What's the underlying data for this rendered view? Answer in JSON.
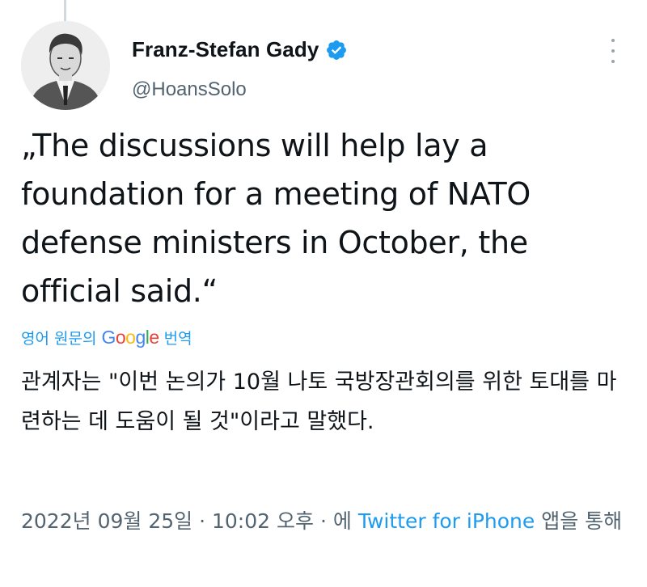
{
  "author": {
    "name": "Franz-Stefan Gady",
    "handle": "@HoansSolo",
    "verified": true
  },
  "tweet": {
    "text": "„The discussions will help lay a foundation for a meeting of NATO defense ministers in October, the official said.“"
  },
  "translation": {
    "prefix": "영어 원문의",
    "logo_letters": [
      "G",
      "o",
      "o",
      "g",
      "l",
      "e"
    ],
    "suffix": "번역",
    "text": "관계자는 \"이번 논의가 10월 나토 국방장관회의를 위한 토대를 마련하는 데 도움이 될 것\"이라고 말했다."
  },
  "meta": {
    "date": "2022년 09월 25일",
    "separator": "·",
    "time": "10:02 오후",
    "via_prefix": "에",
    "client": "Twitter for iPhone",
    "via_suffix": "앱을 통해"
  },
  "colors": {
    "link": "#1d9bf0",
    "verified": "#1d9bf0",
    "secondary_text": "#536471"
  },
  "icons": {
    "verified": "verified-badge-icon",
    "more": "more-options-icon"
  }
}
